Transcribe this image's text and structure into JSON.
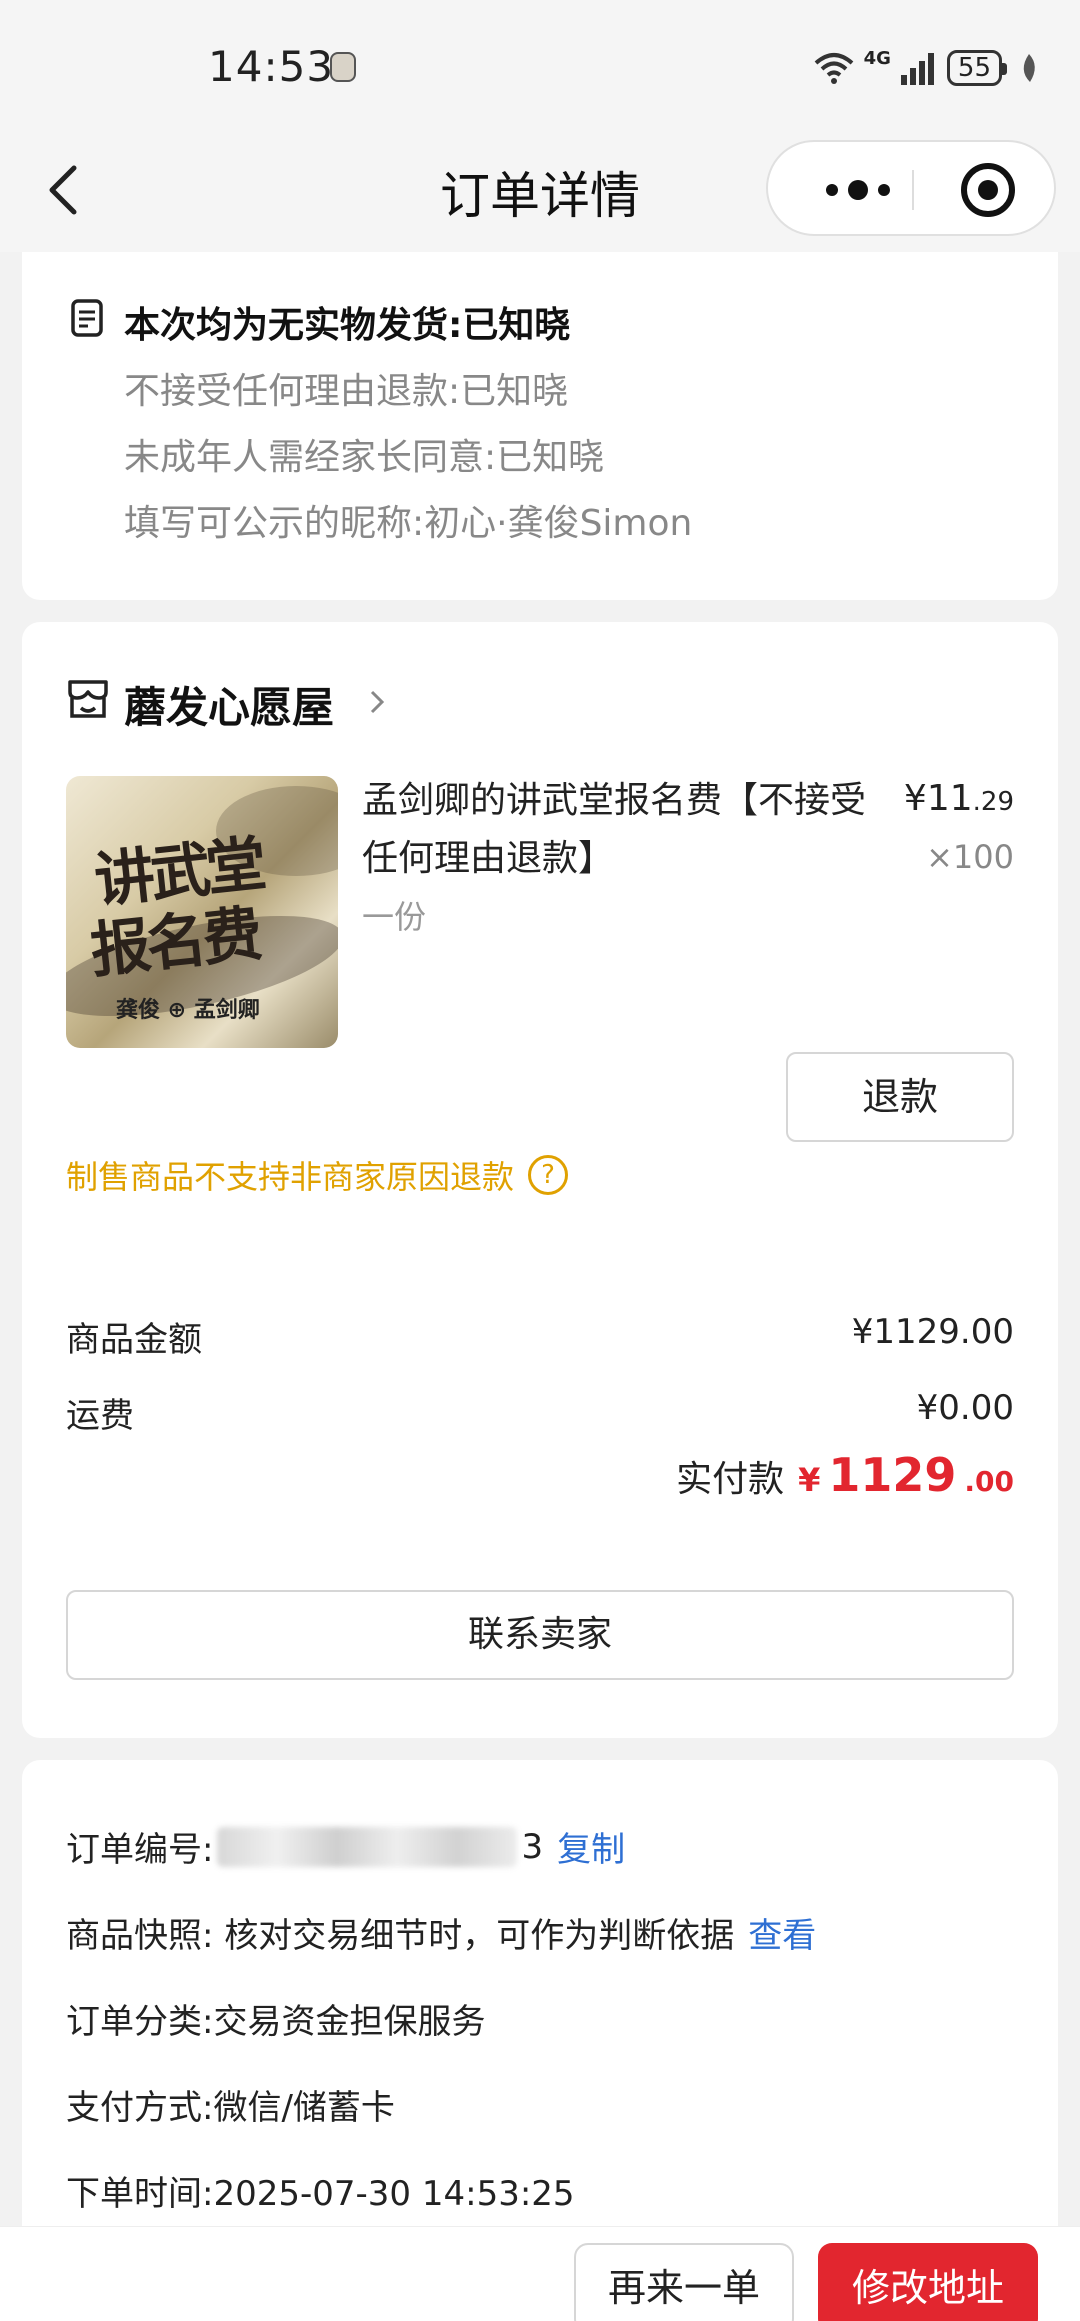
{
  "status_bar": {
    "time": "14:53",
    "network": "4G",
    "battery": "55",
    "icons": [
      "wifi-icon",
      "signal-icon",
      "battery-icon",
      "leaf-icon"
    ]
  },
  "nav": {
    "title": "订单详情",
    "back_icon": "chevron-left-icon",
    "more_icon": "more-dots-icon",
    "close_icon": "target-close-icon"
  },
  "notes": {
    "lines": [
      "本次均为无实物发货:已知晓",
      "不接受任何理由退款:已知晓",
      "未成年人需经家长同意:已知晓",
      "填写可公示的昵称:初心·龚俊Simon"
    ]
  },
  "shop": {
    "name": "蘑发心愿屋",
    "product": {
      "title": "孟剑卿的讲武堂报名费【不接受任何理由退款】",
      "spec": "一份",
      "price_int": "¥11",
      "price_dec": ".29",
      "quantity": "×100",
      "image_text_line1": "讲武堂",
      "image_text_line2": "报名费",
      "image_signature": "龚俊 ⊕ 孟剑卿"
    },
    "refund_label": "退款",
    "warning": "制售商品不支持非商家原因退款",
    "goods_amount_label": "商品金额",
    "goods_amount": "¥1129.00",
    "shipping_label": "运费",
    "shipping": "¥0.00",
    "paid_label": "实付款",
    "paid_currency": "¥",
    "paid_int": "1129",
    "paid_dec": ".00",
    "contact_label": "联系卖家"
  },
  "order_info": {
    "order_no_label": "订单编号:",
    "order_no_tail": "3",
    "copy_label": "复制",
    "snapshot_text": "商品快照: 核对交易细节时，可作为判断依据",
    "snapshot_link": "查看",
    "category": "订单分类:交易资金担保服务",
    "payment": "支付方式:微信/储蓄卡",
    "order_time": "下单时间:2025-07-30 14:53:25"
  },
  "bottom": {
    "again_label": "再来一单",
    "modify_label": "修改地址"
  },
  "colors": {
    "accent_red": "#e2262f",
    "warning_yellow": "#e0a100",
    "link_blue": "#2e6fd3"
  }
}
